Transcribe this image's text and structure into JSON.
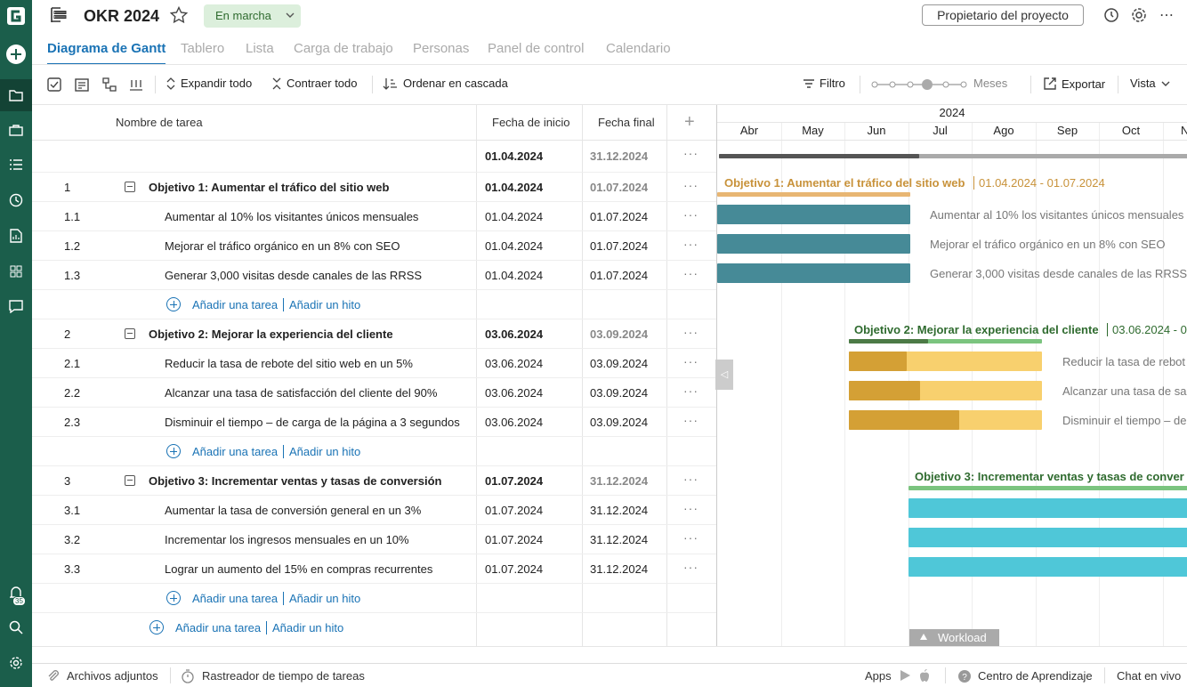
{
  "project": {
    "title": "OKR 2024",
    "status": "En marcha",
    "owner_button": "Propietario del proyecto"
  },
  "tabs": [
    "Diagrama de Gantt",
    "Tablero",
    "Lista",
    "Carga de trabajo",
    "Personas",
    "Panel de control",
    "Calendario"
  ],
  "toolbar": {
    "expand": "Expandir todo",
    "collapse": "Contraer todo",
    "cascade": "Ordenar en cascada",
    "filter": "Filtro",
    "zoom": "Meses",
    "export": "Exportar",
    "view": "Vista"
  },
  "grid_headers": {
    "name": "Nombre de tarea",
    "start": "Fecha de inicio",
    "end": "Fecha final"
  },
  "summary": {
    "start": "01.04.2024",
    "end": "31.12.2024"
  },
  "rows": [
    {
      "num": "1",
      "name": "Objetivo 1: Aumentar el tráfico del sitio web",
      "start": "01.04.2024",
      "end": "01.07.2024"
    },
    {
      "num": "1.1",
      "name": "Aumentar al 10% los visitantes únicos mensuales",
      "start": "01.04.2024",
      "end": "01.07.2024"
    },
    {
      "num": "1.2",
      "name": "Mejorar el tráfico orgánico en un 8% con SEO",
      "start": "01.04.2024",
      "end": "01.07.2024"
    },
    {
      "num": "1.3",
      "name": "Generar 3,000 visitas desde canales de las RRSS",
      "start": "01.04.2024",
      "end": "01.07.2024"
    },
    {
      "num": "2",
      "name": "Objetivo 2: Mejorar la experiencia del cliente",
      "start": "03.06.2024",
      "end": "03.09.2024"
    },
    {
      "num": "2.1",
      "name": "Reducir la tasa de rebote del sitio web en un 5%",
      "start": "03.06.2024",
      "end": "03.09.2024"
    },
    {
      "num": "2.2",
      "name": "Alcanzar una tasa de satisfacción del cliente del 90%",
      "start": "03.06.2024",
      "end": "03.09.2024"
    },
    {
      "num": "2.3",
      "name": "Disminuir el tiempo – de carga de la página a 3 segundos",
      "start": "03.06.2024",
      "end": "03.09.2024"
    },
    {
      "num": "3",
      "name": "Objetivo 3: Incrementar ventas y tasas de conversión",
      "start": "01.07.2024",
      "end": "31.12.2024"
    },
    {
      "num": "3.1",
      "name": "Aumentar la tasa de conversión general en un 3%",
      "start": "01.07.2024",
      "end": "31.12.2024"
    },
    {
      "num": "3.2",
      "name": "Incrementar los ingresos mensuales en un 10%",
      "start": "01.07.2024",
      "end": "31.12.2024"
    },
    {
      "num": "3.3",
      "name": "Lograr un aumento del 15% en compras recurrentes",
      "start": "01.07.2024",
      "end": "31.12.2024"
    }
  ],
  "add_task": "Añadir una tarea",
  "add_milestone": "Añadir un hito",
  "gantt": {
    "year": "2024",
    "months": [
      "Abr",
      "May",
      "Jun",
      "Jul",
      "Ago",
      "Sep",
      "Oct",
      "N"
    ],
    "g1_label": "Objetivo 1: Aumentar el tráfico del sitio web",
    "g1_range": "01.04.2024 - 01.07.2024",
    "g2_label": "Objetivo 2: Mejorar la experiencia del cliente",
    "g2_range": "03.06.2024 - 0",
    "g3_label": "Objetivo 3: Incrementar ventas y tasas de conver",
    "t11": "Aumentar al 10% los visitantes únicos mensuales",
    "t12": "Mejorar el tráfico orgánico en un 8% con SEO",
    "t13": "Generar 3,000 visitas desde canales de las RRSS",
    "t21": "Reducir la tasa de rebot",
    "t22": "Alcanzar una tasa de sa",
    "t23": "Disminuir el tiempo – de",
    "workload": "Workload"
  },
  "sidebar": {
    "notifications_count": "35"
  },
  "footer": {
    "attachments": "Archivos adjuntos",
    "tracker": "Rastreador de tiempo de tareas",
    "apps": "Apps",
    "learning": "Centro de Aprendizaje",
    "chat": "Chat en vivo"
  }
}
